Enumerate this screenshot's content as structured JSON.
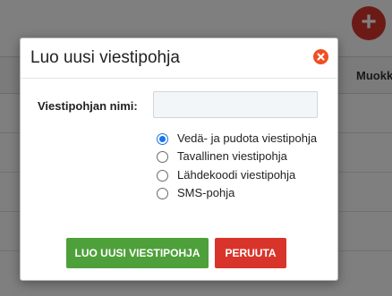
{
  "background": {
    "add_button_label": "+",
    "column_header": "Muokk"
  },
  "modal": {
    "title": "Luo uusi viestipohja",
    "name_label": "Viestipohjan nimi:",
    "name_value": "",
    "name_placeholder": "",
    "template_types": [
      {
        "label": "Vedä- ja pudota viestipohja",
        "selected": true
      },
      {
        "label": "Tavallinen viestipohja",
        "selected": false
      },
      {
        "label": "Lähdekoodi viestipohja",
        "selected": false
      },
      {
        "label": "SMS-pohja",
        "selected": false
      }
    ],
    "create_button": "LUO UUSI VIESTIPOHJA",
    "cancel_button": "PERUUTA"
  },
  "colors": {
    "create_button": "#4ea03a",
    "cancel_button": "#d9342b",
    "close_icon": "#f04e23",
    "add_button": "#d9352d",
    "radio_selected": "#1a73e8"
  },
  "icons": {
    "close": "close-circle-icon",
    "add": "plus-icon"
  }
}
